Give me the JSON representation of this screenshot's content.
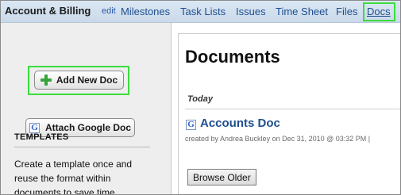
{
  "header": {
    "project_title": "Account & Billing",
    "edit_label": "edit",
    "tabs": [
      {
        "label": "Milestones"
      },
      {
        "label": "Task Lists"
      },
      {
        "label": "Issues"
      },
      {
        "label": "Time Sheet"
      },
      {
        "label": "Files"
      },
      {
        "label": "Docs",
        "active": true
      }
    ]
  },
  "sidebar": {
    "add_doc_label": "Add New Doc",
    "attach_google_label": "Attach Google Doc",
    "google_icon_glyph": "G",
    "templates_heading": "TEMPLATES",
    "templates_text": "Create a template once and reuse the format within documents to save time"
  },
  "main": {
    "page_title": "Documents",
    "section_label": "Today",
    "documents": [
      {
        "title": "Accounts Doc",
        "meta": "created by Andrea Buckley on Dec 31, 2010 @ 03:32 PM |",
        "icon_glyph": "G"
      }
    ],
    "browse_older_label": "Browse Older"
  },
  "colors": {
    "nav_bar": "#cad9ea",
    "link": "#1f4f8f",
    "highlight": "#3ddc3d",
    "sidebar_bg": "#eeeeee",
    "plus_icon": "#35a53b"
  }
}
